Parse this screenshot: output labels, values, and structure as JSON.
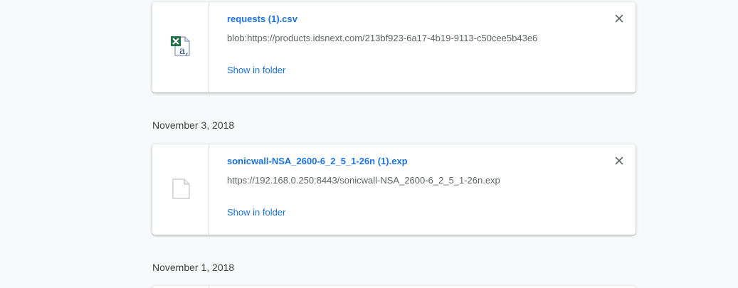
{
  "downloads": [
    {
      "file_name": "requests (1).csv",
      "url": "blob:https://products.idsnext.com/213bf923-6a17-4b19-9113-c50cee5b43e6",
      "action_label": "Show in folder",
      "icon": "excel-file-icon"
    },
    {
      "file_name": "sonicwall-NSA_2600-6_2_5_1-26n (1).exp",
      "url": "https://192.168.0.250:8443/sonicwall-NSA_2600-6_2_5_1-26n.exp",
      "action_label": "Show in folder",
      "icon": "generic-file-icon"
    }
  ],
  "date_groups": [
    {
      "label": "November 3, 2018"
    },
    {
      "label": "November 1, 2018"
    }
  ],
  "colors": {
    "link": "#1a73e8",
    "secondary_text": "#5f6368",
    "background": "#f8f9fa",
    "card": "#ffffff"
  }
}
